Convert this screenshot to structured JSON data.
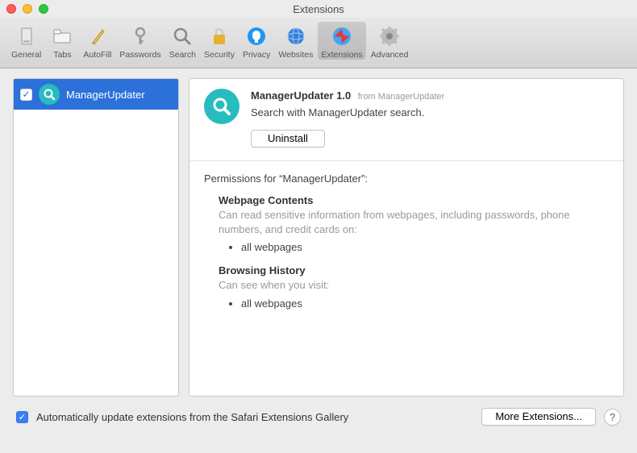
{
  "window": {
    "title": "Extensions"
  },
  "toolbar": {
    "items": [
      {
        "label": "General"
      },
      {
        "label": "Tabs"
      },
      {
        "label": "AutoFill"
      },
      {
        "label": "Passwords"
      },
      {
        "label": "Search"
      },
      {
        "label": "Security"
      },
      {
        "label": "Privacy"
      },
      {
        "label": "Websites"
      },
      {
        "label": "Extensions"
      },
      {
        "label": "Advanced"
      }
    ]
  },
  "sidebar": {
    "items": [
      {
        "name": "ManagerUpdater",
        "checked": true
      }
    ]
  },
  "detail": {
    "title": "ManagerUpdater 1.0",
    "from": "from ManagerUpdater",
    "desc": "Search with ManagerUpdater search.",
    "uninstall": "Uninstall",
    "permissions_for": "Permissions for “ManagerUpdater”:",
    "sections": [
      {
        "title": "Webpage Contents",
        "desc": "Can read sensitive information from webpages, including passwords, phone numbers, and credit cards on:",
        "items": [
          "all webpages"
        ]
      },
      {
        "title": "Browsing History",
        "desc": "Can see when you visit:",
        "items": [
          "all webpages"
        ]
      }
    ]
  },
  "footer": {
    "auto_update": "Automatically update extensions from the Safari Extensions Gallery",
    "more": "More Extensions...",
    "help": "?"
  }
}
